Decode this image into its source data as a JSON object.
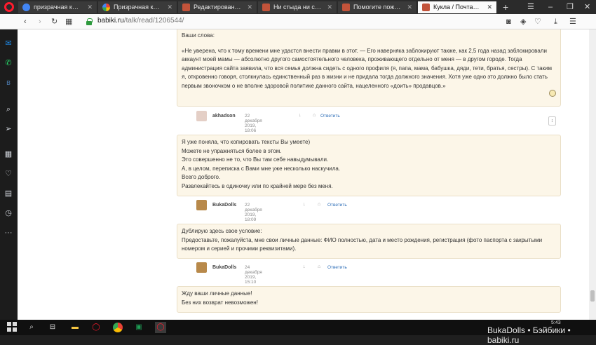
{
  "tabs": [
    {
      "title": "призрачная красота сл",
      "favicon_color": "#4285f4"
    },
    {
      "title": "Призрачная красота / С",
      "favicon_color": "#e94235"
    },
    {
      "title": "Редактирование топика",
      "favicon_color": "#c2533a"
    },
    {
      "title": "Ни стыда ни совести / Б",
      "favicon_color": "#c2533a"
    },
    {
      "title": "Помогите пожалуйста р",
      "favicon_color": "#c2533a"
    },
    {
      "title": "Кукла / Почта / Бэйбик",
      "favicon_color": "#c2533a",
      "active": true
    }
  ],
  "new_tab": "+",
  "window_controls": [
    "☰",
    "–",
    "❐",
    "✕"
  ],
  "address": {
    "host": "babiki.ru",
    "path": "/talk/read/1206544/"
  },
  "comments": [
    {
      "lines_quote_header": "Ваши слова:",
      "paragraph": "«Не уверена, что к тому времени мне удастся внести правки в этот. — Его наверняка заблокируют также, как 2,5 года назад заблокировали аккаунт моей мамы — абсолютно другого самостоятельного человека, проживающего отдельно от меня — в другом городе. Тогда администрация сайта заявила, что вся семья должна сидеть с одного профиля (я, папа, мама, бабушка, дяди, тети, братья, сестры). С таким я, откровенно говоря, столкнулась единственный раз в жизни и не придала тогда должного значения. Хотя уже одно это должно было стать первым звоночком о не вполне здоровой политике данного сайта, нацеленного «доить» продавцов.»",
      "author": "akhadson",
      "date": "22 декабря 2019, 18:06",
      "reply": "Ответить"
    },
    {
      "lines": [
        "Я уже поняла, что копировать тексты Вы умеете)",
        "Можете не упражняться более в этом.",
        "Это совершенно не то, что Вы там себе навыдумывали.",
        "А, в целом, переписка с Вами мне уже несколько наскучила.",
        "Всего доброго.",
        "Развлекайтесь в одиночку или по крайней мере без меня."
      ],
      "author": "BukaDolls",
      "date": "22 декабря 2019, 18:09",
      "reply": "Ответить"
    },
    {
      "lines": [
        "Дублирую здесь свое условие:",
        "Предоставьте, пожалуйста, мне свои личные данные: ФИО полностью, дата и место рождения, регистрация (фото паспорта с закрытыми номером и серией и прочими реквизитами)."
      ],
      "author": "BukaDolls",
      "date": "24 декабря 2019, 15:10",
      "reply": "Ответить"
    },
    {
      "lines": [
        "Жду ваши личные данные!",
        "Без них возврат невозможен!"
      ]
    }
  ],
  "scroll_badge": "↕",
  "taskbar": {
    "clock": "5:43",
    "watermark": "BukaDolls • Бэйбики • babiki.ru"
  }
}
